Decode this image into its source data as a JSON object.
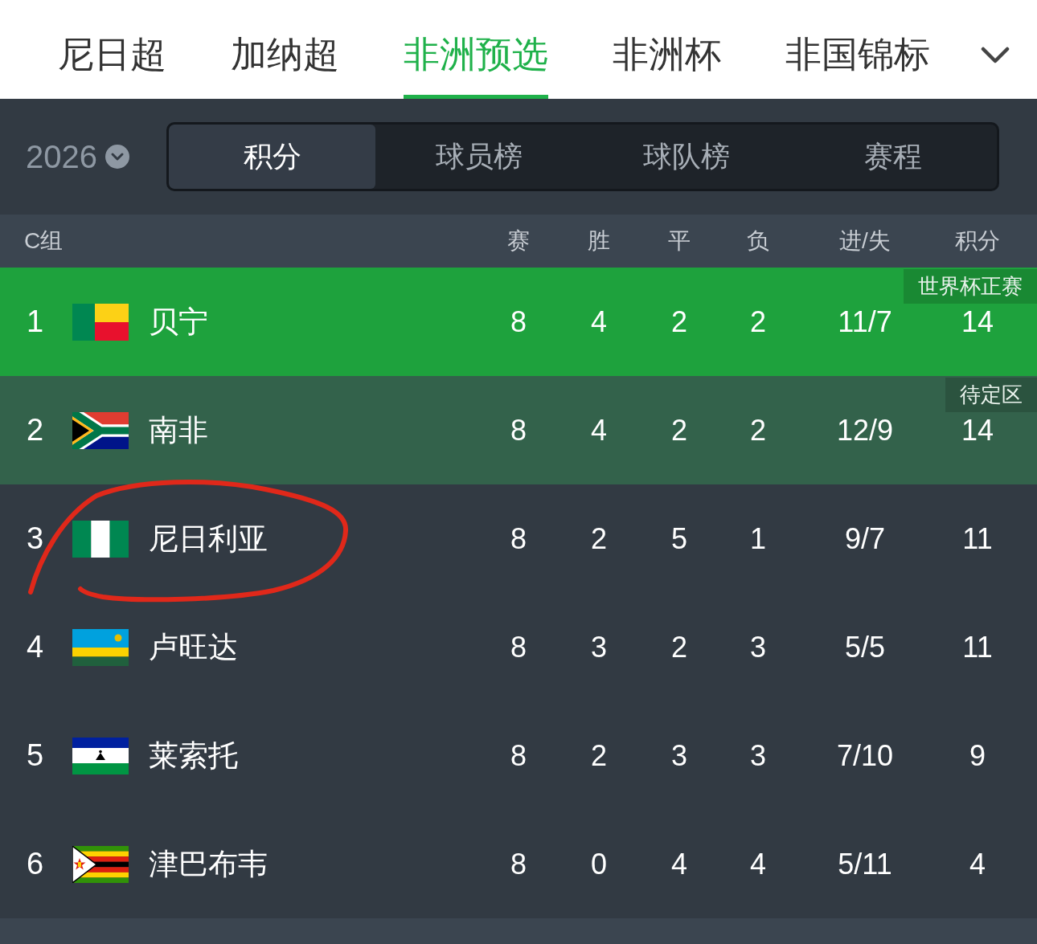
{
  "league_tabs": [
    {
      "label": "尼日超",
      "selected": false
    },
    {
      "label": "加纳超",
      "selected": false
    },
    {
      "label": "非洲预选",
      "selected": true
    },
    {
      "label": "非洲杯",
      "selected": false
    },
    {
      "label": "非国锦标",
      "selected": false
    }
  ],
  "season": {
    "year": "2026"
  },
  "view_tabs": [
    {
      "label": "积分",
      "selected": true
    },
    {
      "label": "球员榜",
      "selected": false
    },
    {
      "label": "球队榜",
      "selected": false
    },
    {
      "label": "赛程",
      "selected": false
    }
  ],
  "table": {
    "group": "C组",
    "columns": [
      "赛",
      "胜",
      "平",
      "负",
      "进/失",
      "积分"
    ],
    "rows": [
      {
        "rank": "1",
        "flag": {
          "kind": "benin"
        },
        "team": "贝宁",
        "stats": [
          "8",
          "4",
          "2",
          "2",
          "11/7",
          "14"
        ],
        "color": "#1ea23d",
        "badge": "世界杯正赛",
        "circled": false
      },
      {
        "rank": "2",
        "flag": {
          "kind": "southafrica"
        },
        "team": "南非",
        "stats": [
          "8",
          "4",
          "2",
          "2",
          "12/9",
          "14"
        ],
        "color": "#33624b",
        "badge": "待定区",
        "circled": false
      },
      {
        "rank": "3",
        "flag": {
          "kind": "nigeria"
        },
        "team": "尼日利亚",
        "stats": [
          "8",
          "2",
          "5",
          "1",
          "9/7",
          "11"
        ],
        "circled": true
      },
      {
        "rank": "4",
        "flag": {
          "kind": "rwanda"
        },
        "team": "卢旺达",
        "stats": [
          "8",
          "3",
          "2",
          "3",
          "5/5",
          "11"
        ],
        "circled": false
      },
      {
        "rank": "5",
        "flag": {
          "kind": "lesotho"
        },
        "team": "莱索托",
        "stats": [
          "8",
          "2",
          "3",
          "3",
          "7/10",
          "9"
        ],
        "circled": false
      },
      {
        "rank": "6",
        "flag": {
          "kind": "zimbabwe"
        },
        "team": "津巴布韦",
        "stats": [
          "8",
          "0",
          "4",
          "4",
          "5/11",
          "4"
        ],
        "circled": false
      }
    ]
  }
}
